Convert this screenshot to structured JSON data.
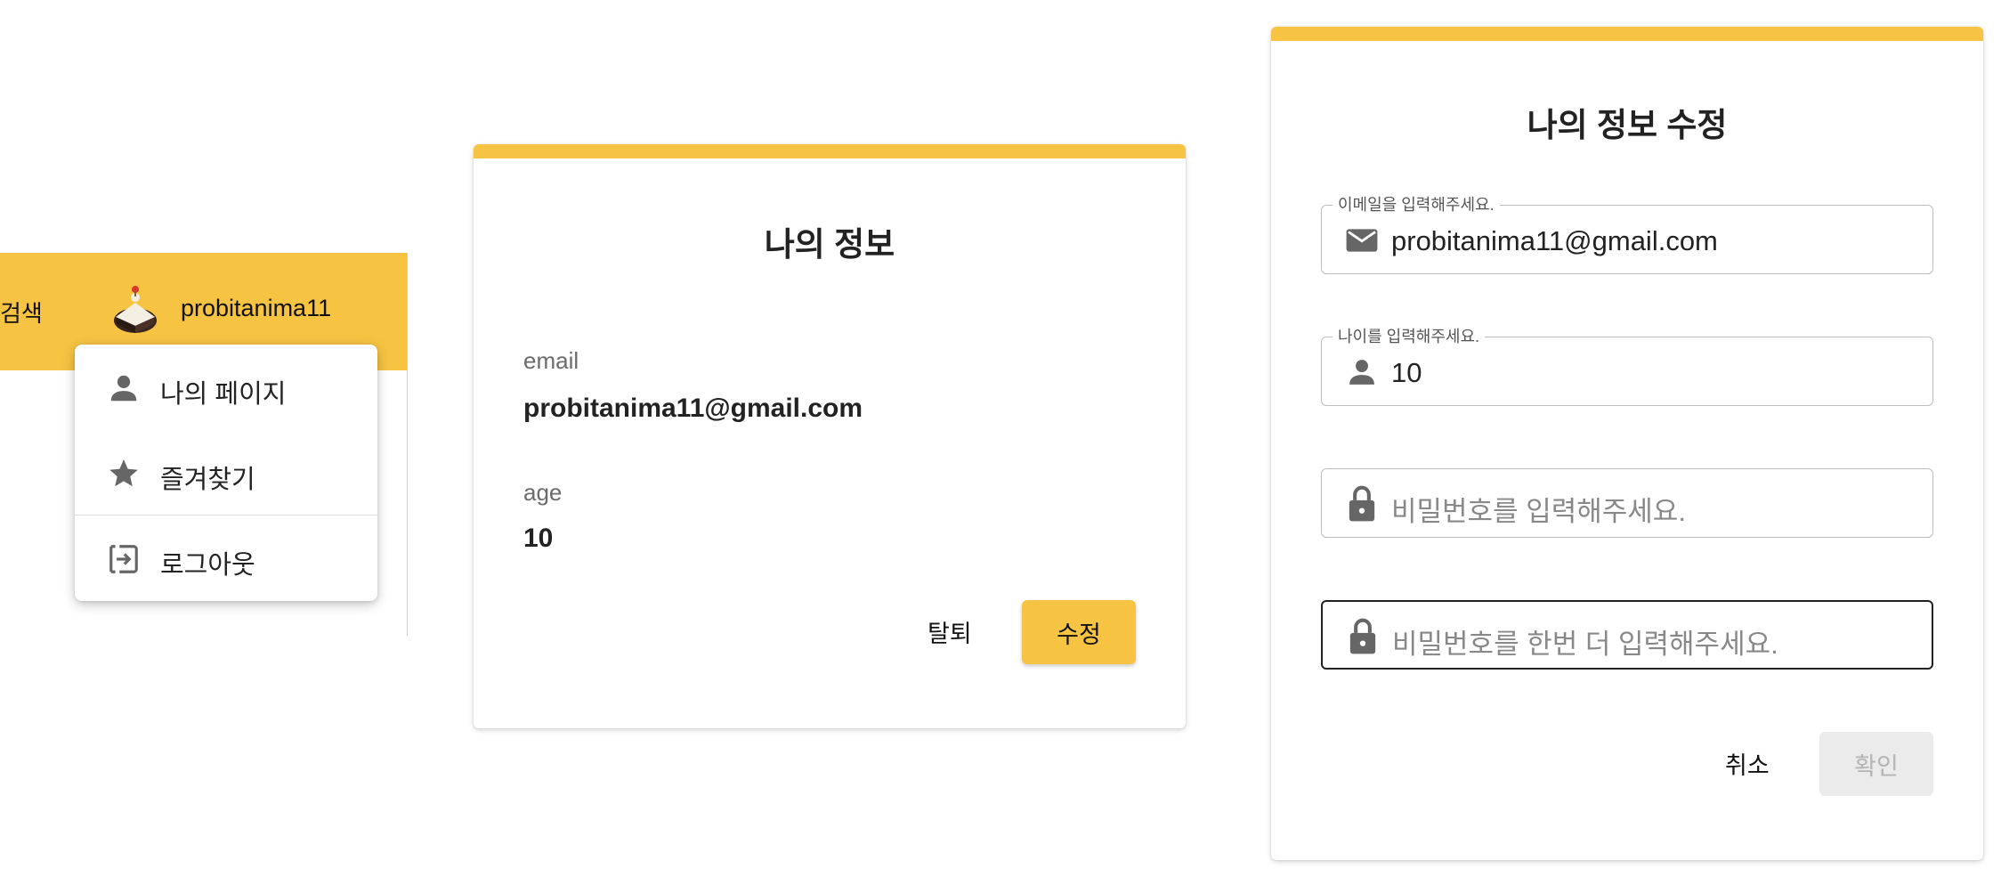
{
  "header": {
    "search_label": "검색",
    "username": "probitanima11",
    "accent_color": "#f6c342",
    "avatar_icon": "cake-avatar"
  },
  "user_menu": {
    "items": [
      {
        "label": "나의 페이지",
        "icon": "person-icon"
      },
      {
        "label": "즐겨찾기",
        "icon": "star-icon"
      },
      {
        "label": "로그아웃",
        "icon": "logout-icon"
      }
    ]
  },
  "profile_card": {
    "title": "나의 정보",
    "email_label": "email",
    "email_value": "probitanima11@gmail.com",
    "age_label": "age",
    "age_value": "10",
    "withdraw_label": "탈퇴",
    "edit_label": "수정"
  },
  "edit_card": {
    "title": "나의 정보 수정",
    "email_field": {
      "label": "이메일을 입력해주세요.",
      "value": "probitanima11@gmail.com",
      "icon": "mail-icon"
    },
    "age_field": {
      "label": "나이를 입력해주세요.",
      "value": "10",
      "icon": "person-icon"
    },
    "password_field": {
      "placeholder": "비밀번호를 입력해주세요.",
      "icon": "lock-icon"
    },
    "password_confirm_field": {
      "placeholder": "비밀번호를 한번 더 입력해주세요.",
      "icon": "lock-icon"
    },
    "cancel_label": "취소",
    "confirm_label": "확인"
  }
}
